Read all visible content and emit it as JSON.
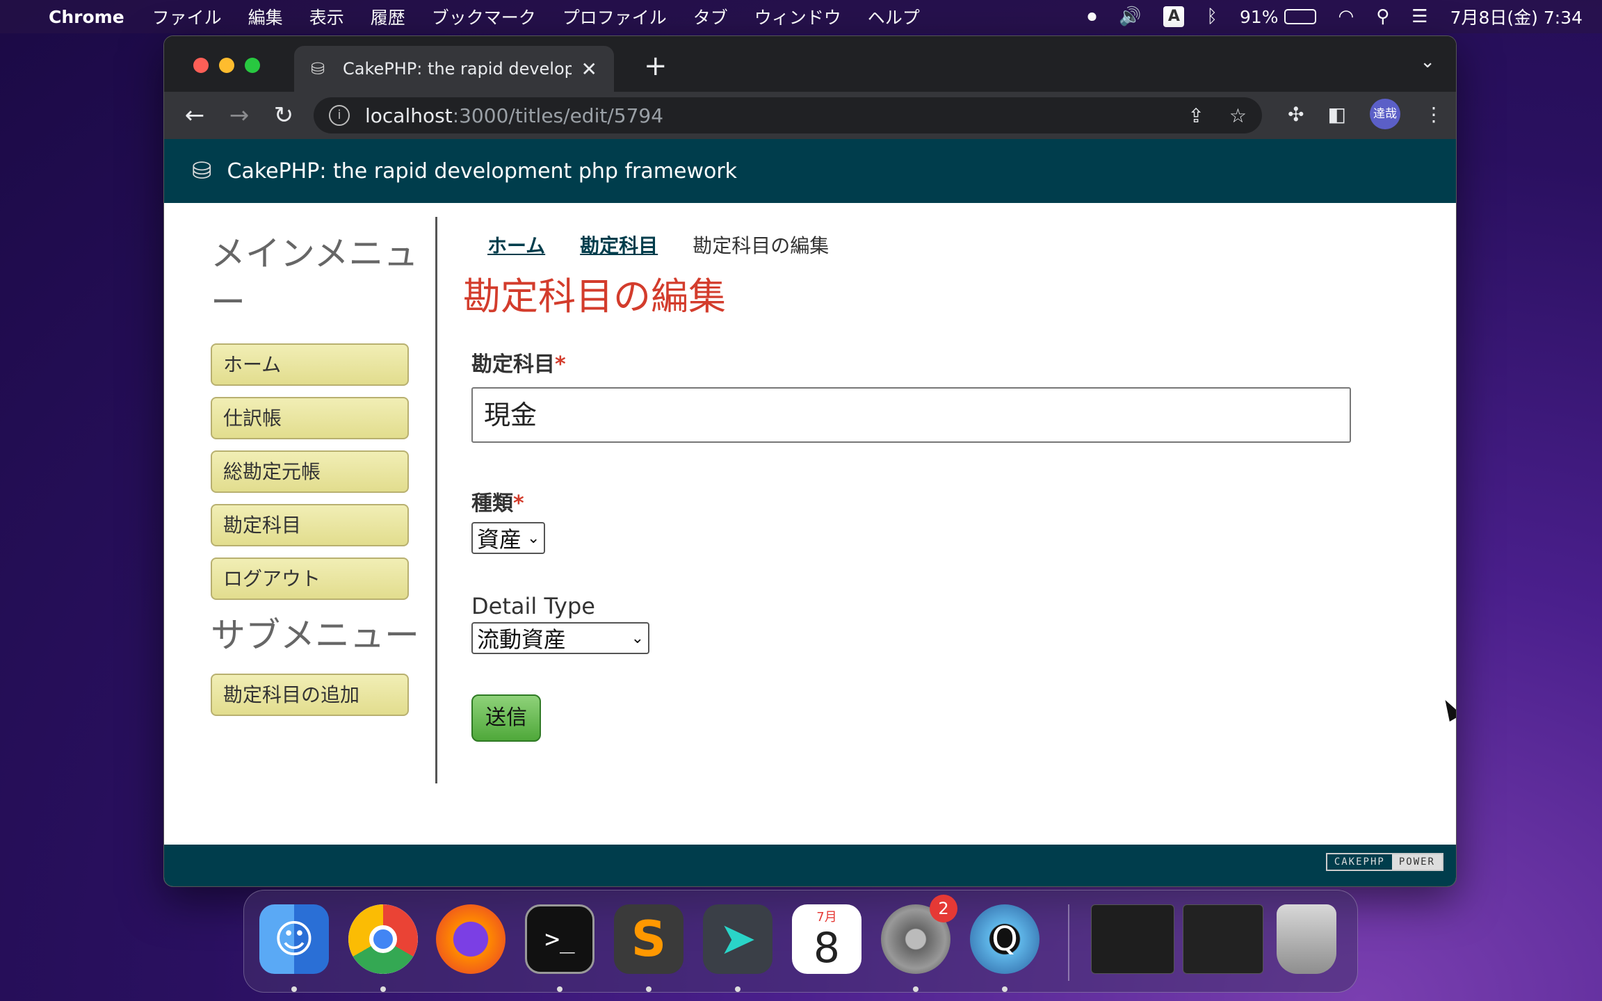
{
  "menubar": {
    "app_name": "Chrome",
    "menus": [
      "ファイル",
      "編集",
      "表示",
      "履歴",
      "ブックマーク",
      "プロファイル",
      "タブ",
      "ウィンドウ",
      "ヘルプ"
    ],
    "input_indicator": "A",
    "battery_percent": "91%",
    "battery_level": 0.91,
    "clock": "7月8日(金) 7:34"
  },
  "browser": {
    "tab_title": "CakePHP: the rapid developme",
    "url_host": "localhost",
    "url_path": ":3000/titles/edit/5794",
    "avatar_text": "達哉"
  },
  "site": {
    "header_title": "CakePHP: the rapid development php framework",
    "footer_badge_left": "CAKEPHP",
    "footer_badge_right": "POWER"
  },
  "sidebar": {
    "main_menu_title": "メインメニュー",
    "main_items": [
      {
        "label": "ホーム"
      },
      {
        "label": "仕訳帳"
      },
      {
        "label": "総勘定元帳"
      },
      {
        "label": "勘定科目"
      },
      {
        "label": "ログアウト"
      }
    ],
    "sub_menu_title": "サブメニュー",
    "sub_items": [
      {
        "label": "勘定科目の追加"
      }
    ]
  },
  "breadcrumb": {
    "home": "ホーム",
    "accounts": "勘定科目",
    "current": "勘定科目の編集"
  },
  "main": {
    "heading": "勘定科目の編集",
    "account_label": "勘定科目",
    "required_mark": "*",
    "account_value": "現金",
    "type_label": "種類",
    "type_value": "資産",
    "detail_type_label": "Detail Type",
    "detail_type_value": "流動資産",
    "submit_label": "送信"
  },
  "dock": {
    "calendar_month": "7月",
    "calendar_day": "8",
    "settings_badge": "2"
  },
  "colors": {
    "header_bg": "#003d4c",
    "heading_red": "#d33c2c",
    "sidebar_button": "#e8e4a0",
    "submit_green": "#5cb85c"
  }
}
